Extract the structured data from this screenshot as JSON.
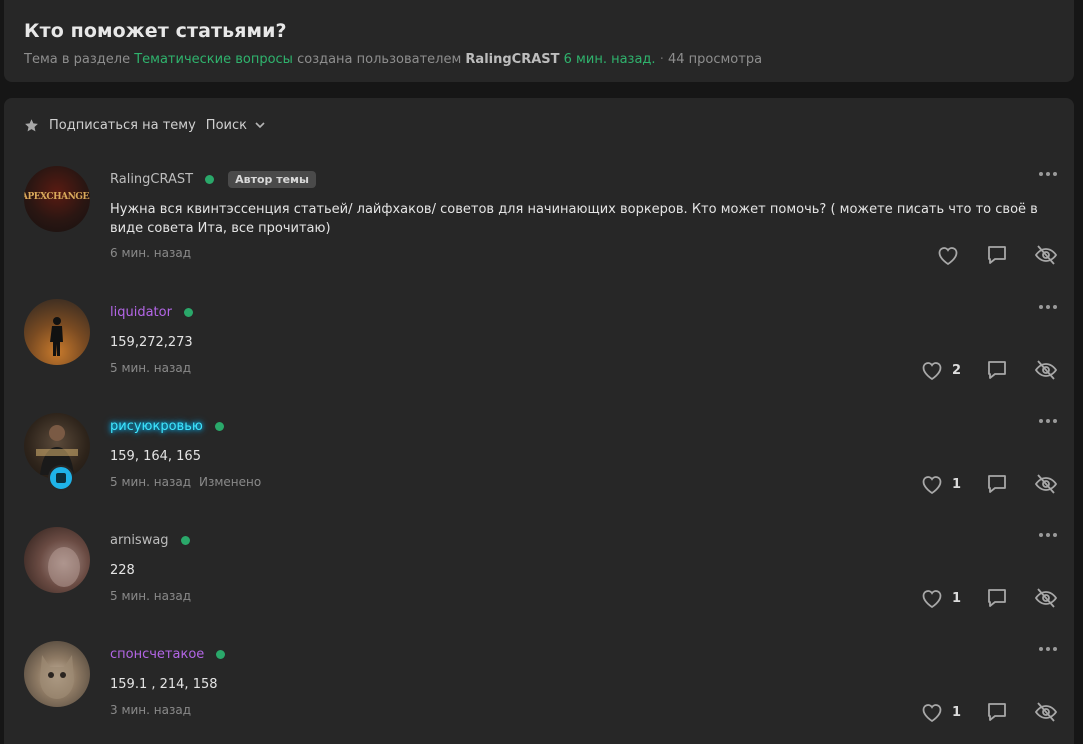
{
  "thread": {
    "title": "Кто поможет статьями?",
    "meta_prefix": "Тема в разделе",
    "section": "Тематические вопросы",
    "meta_created": "создана пользователем",
    "author": "RalingCRAST",
    "created_ago": "6 мин. назад.",
    "views": "44 просмотра"
  },
  "toolbar": {
    "subscribe_label": "Подписаться на тему",
    "search_label": "Поиск"
  },
  "author_tag": "Автор темы",
  "edited_label": "Изменено",
  "avatar1_text": "APEXCHANGE.PRO",
  "posts": [
    {
      "username": "RalingCRAST",
      "text": "Нужна вся квинтэссенция статьей/ лайфхаков/ советов для начинающих воркеров. Кто может помочь? ( можете писать что то своё в виде совета Ита, все прочитаю)",
      "time": "6 мин. назад",
      "likes": ""
    },
    {
      "username": "liquidator",
      "text": "159,272,273",
      "time": "5 мин. назад",
      "likes": "2"
    },
    {
      "username": "рисуюкровью",
      "text": "159, 164, 165",
      "time": "5 мин. назад",
      "likes": "1"
    },
    {
      "username": "arniswag",
      "text": "228",
      "time": "5 мин. назад",
      "likes": "1"
    },
    {
      "username": "спонсчетакое",
      "text": "159.1 , 214, 158",
      "time": "3 мин. назад",
      "likes": "1"
    }
  ],
  "colors": {
    "accent_green": "#2fb36d",
    "username_purple": "#b366e6",
    "username_cyan": "#3fe6ff",
    "online_dot": "#2aa86a"
  },
  "icons": [
    "star-icon",
    "chevron-down-icon",
    "more-icon",
    "heart-icon",
    "reply-icon",
    "hide-icon"
  ]
}
